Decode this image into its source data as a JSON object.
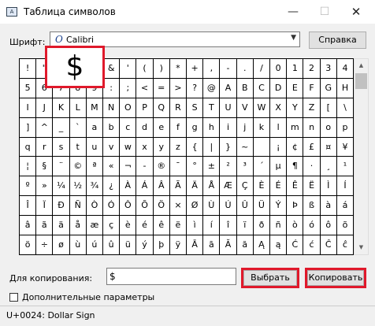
{
  "window": {
    "title": "Таблица символов",
    "minimize": "—",
    "maximize": "☐",
    "close": "✕"
  },
  "font": {
    "label": "Шрифт:",
    "icon": "O",
    "value": "Calibri",
    "dropdown": "▼"
  },
  "help_button": "Справка",
  "grid": {
    "rows": [
      [
        "!",
        "\"",
        "#",
        "$",
        "%",
        "&",
        "'",
        "(",
        ")",
        "*",
        "+",
        ",",
        "-",
        ".",
        "/",
        "0",
        "1",
        "2",
        "3",
        "4"
      ],
      [
        "5",
        "6",
        "7",
        "8",
        "9",
        ":",
        ";",
        "<",
        "=",
        ">",
        "?",
        "@",
        "A",
        "B",
        "C",
        "D",
        "E",
        "F",
        "G",
        "H"
      ],
      [
        "I",
        "J",
        "K",
        "L",
        "M",
        "N",
        "O",
        "P",
        "Q",
        "R",
        "S",
        "T",
        "U",
        "V",
        "W",
        "X",
        "Y",
        "Z",
        "[",
        "\\"
      ],
      [
        "]",
        "^",
        "_",
        "`",
        "a",
        "b",
        "c",
        "d",
        "e",
        "f",
        "g",
        "h",
        "i",
        "j",
        "k",
        "l",
        "m",
        "n",
        "o",
        "p"
      ],
      [
        "q",
        "r",
        "s",
        "t",
        "u",
        "v",
        "w",
        "x",
        "y",
        "z",
        "{",
        "|",
        "}",
        "~",
        " ",
        "¡",
        "¢",
        "£",
        "¤",
        "¥"
      ],
      [
        "¦",
        "§",
        "¨",
        "©",
        "ª",
        "«",
        "¬",
        "-",
        "®",
        "¯",
        "°",
        "±",
        "²",
        "³",
        "´",
        "µ",
        "¶",
        "·",
        "¸",
        "¹"
      ],
      [
        "º",
        "»",
        "¼",
        "½",
        "¾",
        "¿",
        "À",
        "Á",
        "Â",
        "Ã",
        "Ä",
        "Å",
        "Æ",
        "Ç",
        "È",
        "É",
        "Ê",
        "Ë",
        "Ì",
        "Í"
      ],
      [
        "Î",
        "Ï",
        "Ð",
        "Ñ",
        "Ò",
        "Ó",
        "Ô",
        "Õ",
        "Ö",
        "×",
        "Ø",
        "Ù",
        "Ú",
        "Û",
        "Ü",
        "Ý",
        "Þ",
        "ß",
        "à",
        "á"
      ],
      [
        "â",
        "ã",
        "ä",
        "å",
        "æ",
        "ç",
        "è",
        "é",
        "ê",
        "ë",
        "ì",
        "í",
        "î",
        "ï",
        "ð",
        "ñ",
        "ò",
        "ó",
        "ô",
        "õ"
      ],
      [
        "ö",
        "÷",
        "ø",
        "ù",
        "ú",
        "û",
        "ü",
        "ý",
        "þ",
        "ÿ",
        "Ā",
        "ā",
        "Ă",
        "ă",
        "Ą",
        "ą",
        "Ć",
        "ć",
        "Ĉ",
        "ĉ"
      ]
    ]
  },
  "zoom_char": "$",
  "scrollbar": {
    "up": "▲",
    "down": "▼"
  },
  "copy": {
    "label": "Для копирования:",
    "value": "$",
    "select_button": "Выбрать",
    "copy_button": "Копировать"
  },
  "advanced": {
    "label": "Дополнительные параметры",
    "checked": false
  },
  "status": "U+0024: Dollar Sign",
  "colors": {
    "highlight": "#e0192b",
    "font_icon": "#1a3f8b"
  }
}
